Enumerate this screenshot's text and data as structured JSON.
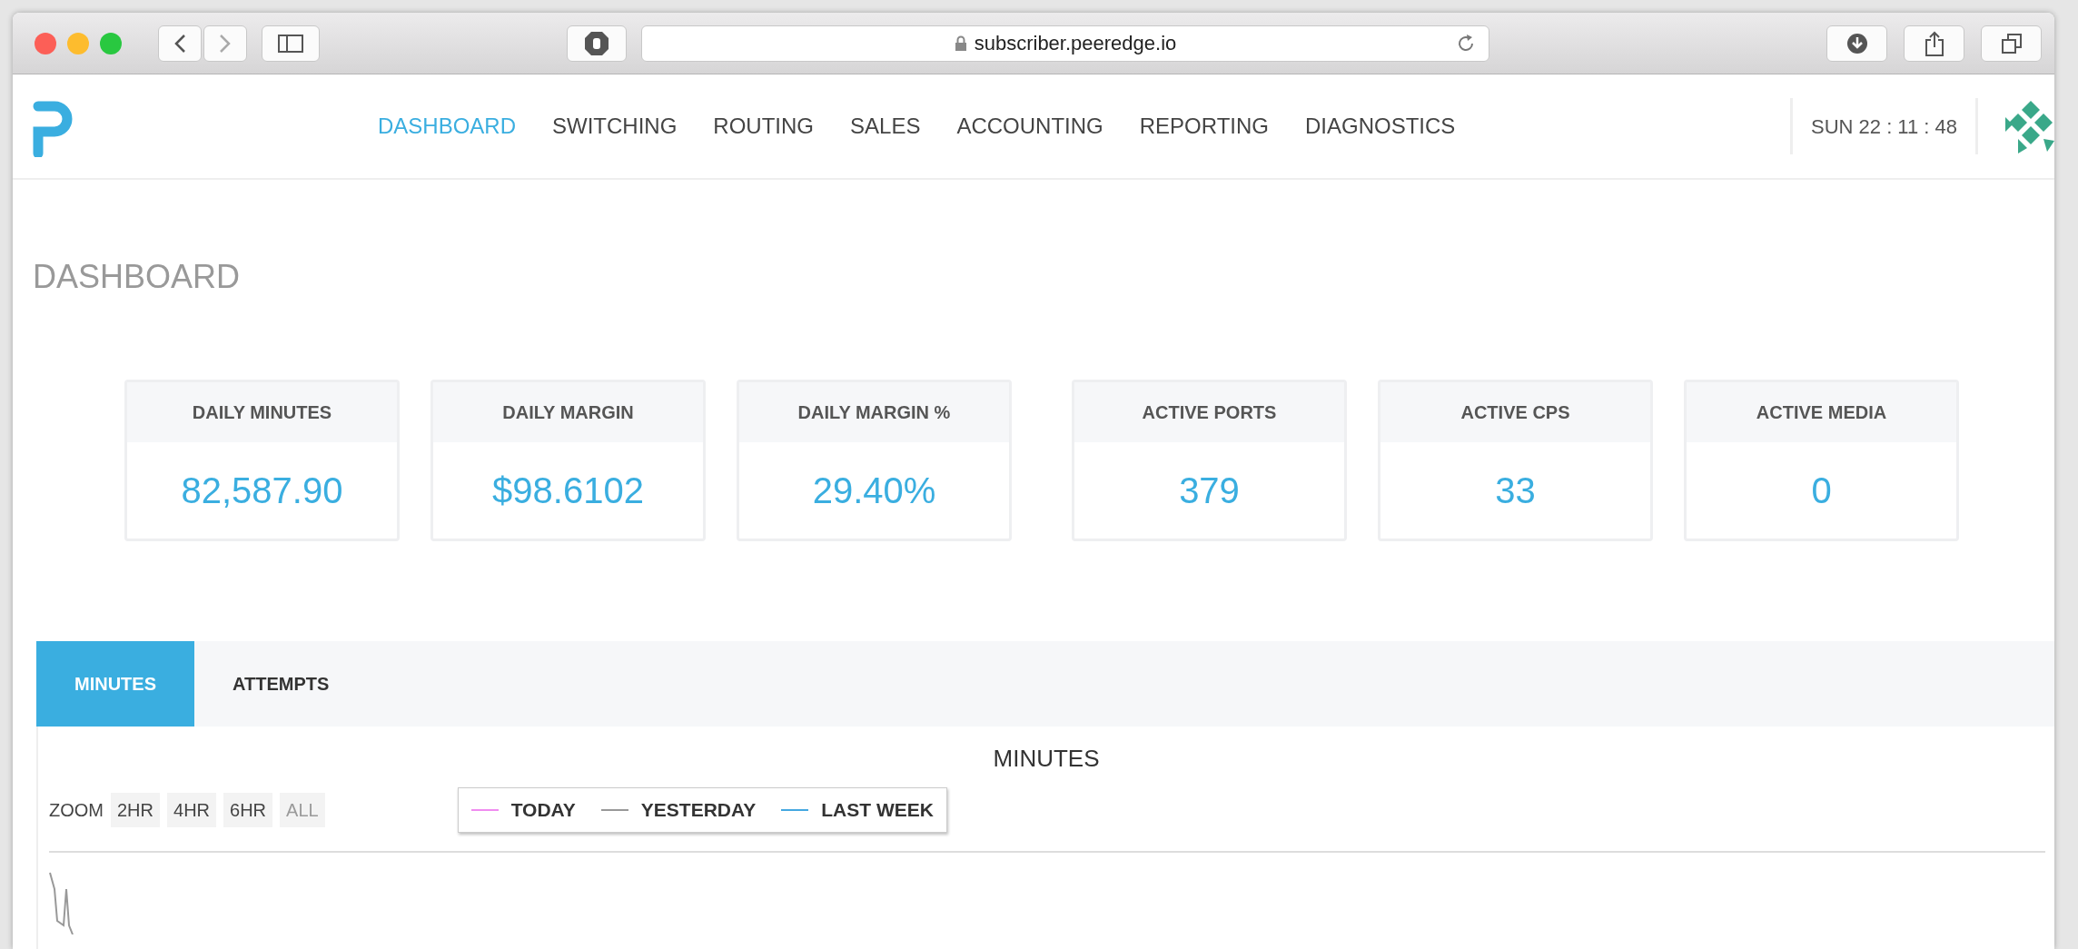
{
  "browser": {
    "url": "subscriber.peeredge.io"
  },
  "nav": {
    "items": [
      {
        "label": "DASHBOARD",
        "selected": true
      },
      {
        "label": "SWITCHING",
        "selected": false
      },
      {
        "label": "ROUTING",
        "selected": false
      },
      {
        "label": "SALES",
        "selected": false
      },
      {
        "label": "ACCOUNTING",
        "selected": false
      },
      {
        "label": "REPORTING",
        "selected": false
      },
      {
        "label": "DIAGNOSTICS",
        "selected": false
      }
    ],
    "clock": "SUN 22 : 11 : 48"
  },
  "page_title": "DASHBOARD",
  "stats": [
    {
      "label": "DAILY MINUTES",
      "value": "82,587.90"
    },
    {
      "label": "DAILY MARGIN",
      "value": "$98.6102"
    },
    {
      "label": "DAILY MARGIN %",
      "value": "29.40%"
    },
    {
      "label": "ACTIVE PORTS",
      "value": "379"
    },
    {
      "label": "ACTIVE CPS",
      "value": "33"
    },
    {
      "label": "ACTIVE MEDIA",
      "value": "0"
    }
  ],
  "tabs": [
    {
      "label": "MINUTES",
      "selected": true
    },
    {
      "label": "ATTEMPTS",
      "selected": false
    }
  ],
  "chart": {
    "title": "MINUTES",
    "zoom_label": "ZOOM",
    "zoom_buttons": [
      {
        "label": "2HR",
        "disabled": false
      },
      {
        "label": "4HR",
        "disabled": false
      },
      {
        "label": "6HR",
        "disabled": false
      },
      {
        "label": "ALL",
        "disabled": true
      }
    ],
    "legend": [
      {
        "label": "TODAY",
        "color": "#f08cf0"
      },
      {
        "label": "YESTERDAY",
        "color": "#999999"
      },
      {
        "label": "LAST WEEK",
        "color": "#45a8e0"
      }
    ]
  }
}
